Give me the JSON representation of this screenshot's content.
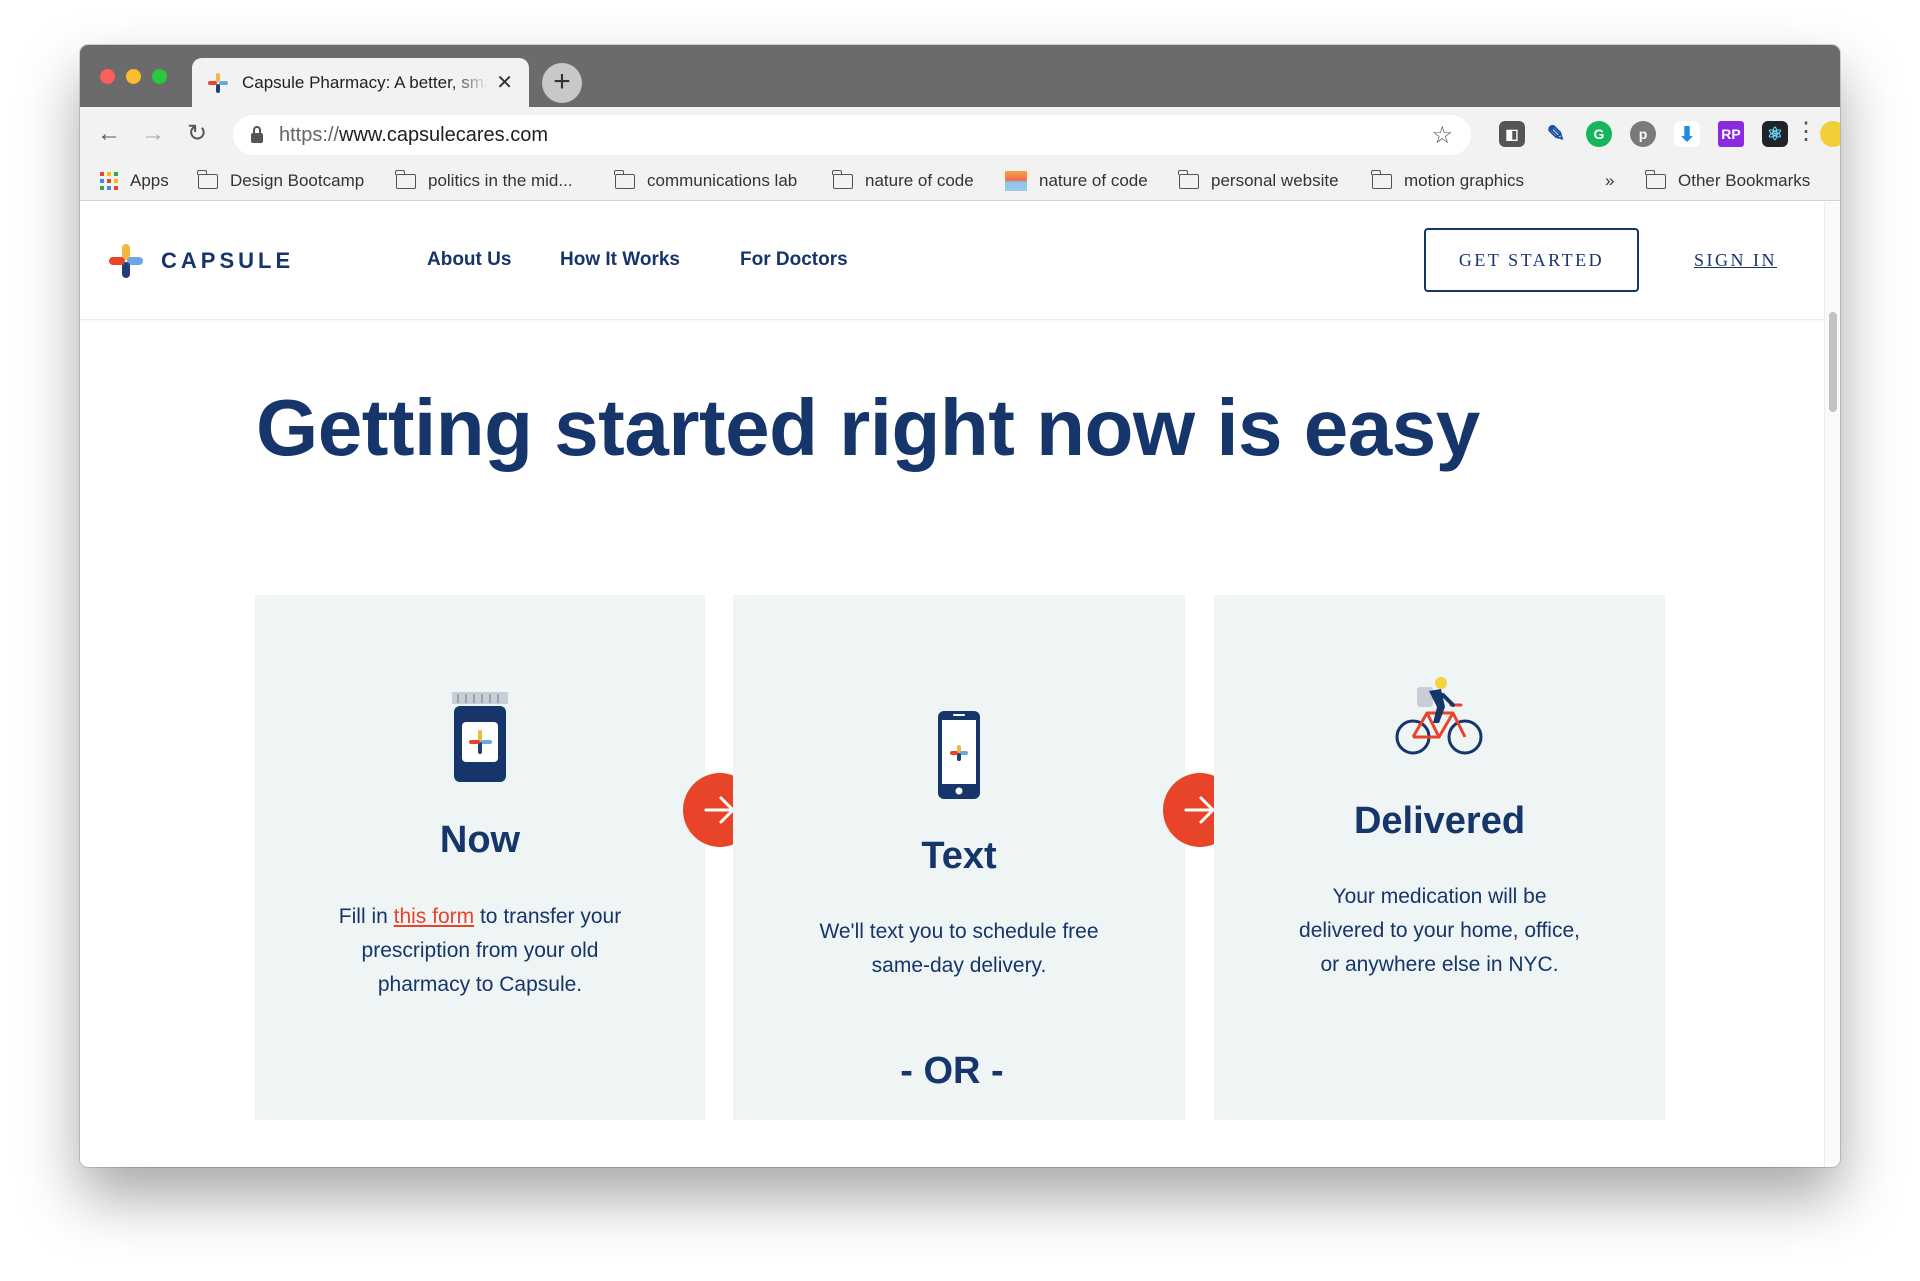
{
  "browser": {
    "tab_title": "Capsule Pharmacy: A better, smarter",
    "url_prefix": "https://",
    "url_host": "www.capsulecares.com",
    "bookmarks": [
      "Apps",
      "Design Bootcamp",
      "politics in the mid...",
      "communications lab",
      "nature of code",
      "nature of code",
      "personal website",
      "motion graphics",
      "Other Bookmarks"
    ],
    "overflow": "»"
  },
  "site": {
    "brand": "CAPSULE",
    "nav": [
      "About Us",
      "How It Works",
      "For Doctors"
    ],
    "get_started": "GET STARTED",
    "sign_in": "SIGN IN"
  },
  "hero": {
    "title": "Getting started right now is easy"
  },
  "steps": [
    {
      "title": "Now",
      "text_before": "Fill in ",
      "link": "this form",
      "text_after": " to transfer your prescription from your old pharmacy to Capsule."
    },
    {
      "title": "Text",
      "text": "We'll text you to schedule free same-day delivery."
    },
    {
      "title": "Delivered",
      "text": "Your medication will be delivered to your home, office, or anywhere else in NYC."
    }
  ],
  "or_label": "- OR -",
  "colors": {
    "navy": "#16356b",
    "accent": "#e8442a",
    "card_bg": "#eff4f4"
  }
}
